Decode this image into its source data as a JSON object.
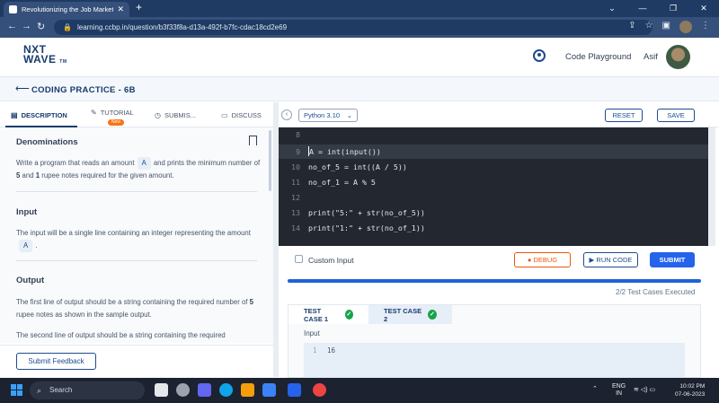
{
  "browser": {
    "tab_title": "Revolutionizing the Job Market |",
    "url": "learning.ccbp.in/question/b3f33f8a-d13a-492f-b7fc-cdac18cd2e69"
  },
  "header": {
    "logo_line1": "NXT",
    "logo_line2": "WAVE",
    "logo_tm": "TM",
    "code_playground": "Code Playground",
    "user_name": "Asif"
  },
  "page": {
    "title": "CODING PRACTICE - 6B"
  },
  "left_tabs": [
    {
      "label": "DESCRIPTION",
      "icon": "description-icon"
    },
    {
      "label": "TUTORIAL",
      "icon": "tutorial-icon",
      "badge": "New"
    },
    {
      "label": "SUBMIS...",
      "icon": "clock-icon"
    },
    {
      "label": "DISCUSS",
      "icon": "chat-icon"
    }
  ],
  "description": {
    "title": "Denominations",
    "intro_1": "Write a program that reads an amount",
    "intro_var": "A",
    "intro_2": "and prints the minimum number of",
    "intro_5": "5",
    "intro_and": "and",
    "intro_1b": "1",
    "intro_3": "rupee notes required for the given amount.",
    "input_title": "Input",
    "input_text": "The input will be a single line containing an integer representing the amount",
    "input_var": "A",
    "output_title": "Output",
    "output_text_1a": "The first line of output should be a string containing the required number of",
    "output_text_1b": "5",
    "output_text_1c": "rupee notes as shown in the sample output.",
    "output_text_2": "The second line of output should be a string containing the required"
  },
  "left_footer": {
    "feedback_label": "Submit Feedback"
  },
  "editor_bar": {
    "language": "Python 3.10",
    "reset_label": "RESET",
    "save_label": "SAVE"
  },
  "code_lines": [
    {
      "num": "8",
      "text": ""
    },
    {
      "num": "9",
      "text": "A = int(input())"
    },
    {
      "num": "10",
      "text": "no_of_5 = int((A / 5))"
    },
    {
      "num": "11",
      "text": "no_of_1 = A % 5"
    },
    {
      "num": "12",
      "text": ""
    },
    {
      "num": "13",
      "text": "print(\"5:\" + str(no_of_5))"
    },
    {
      "num": "14",
      "text": "print(\"1:\" + str(no_of_1))"
    }
  ],
  "actions": {
    "custom_input": "Custom Input",
    "debug": "DEBUG",
    "run_code": "RUN CODE",
    "submit": "SUBMIT"
  },
  "results": {
    "progress": 1.0,
    "executed": "2/2 Test Cases Executed",
    "tabs": [
      "TEST CASE 1",
      "TEST CASE 2"
    ],
    "input_label": "Input",
    "input_line_num": "1",
    "input_value": "16"
  },
  "taskbar": {
    "search": "Search",
    "lang": "ENG",
    "region": "IN",
    "time": "10:02 PM",
    "date": "07-06-2023"
  },
  "colors": {
    "brand": "#183b6e",
    "accent": "#2563eb",
    "success": "#16a34a",
    "debug": "#ea580c"
  }
}
